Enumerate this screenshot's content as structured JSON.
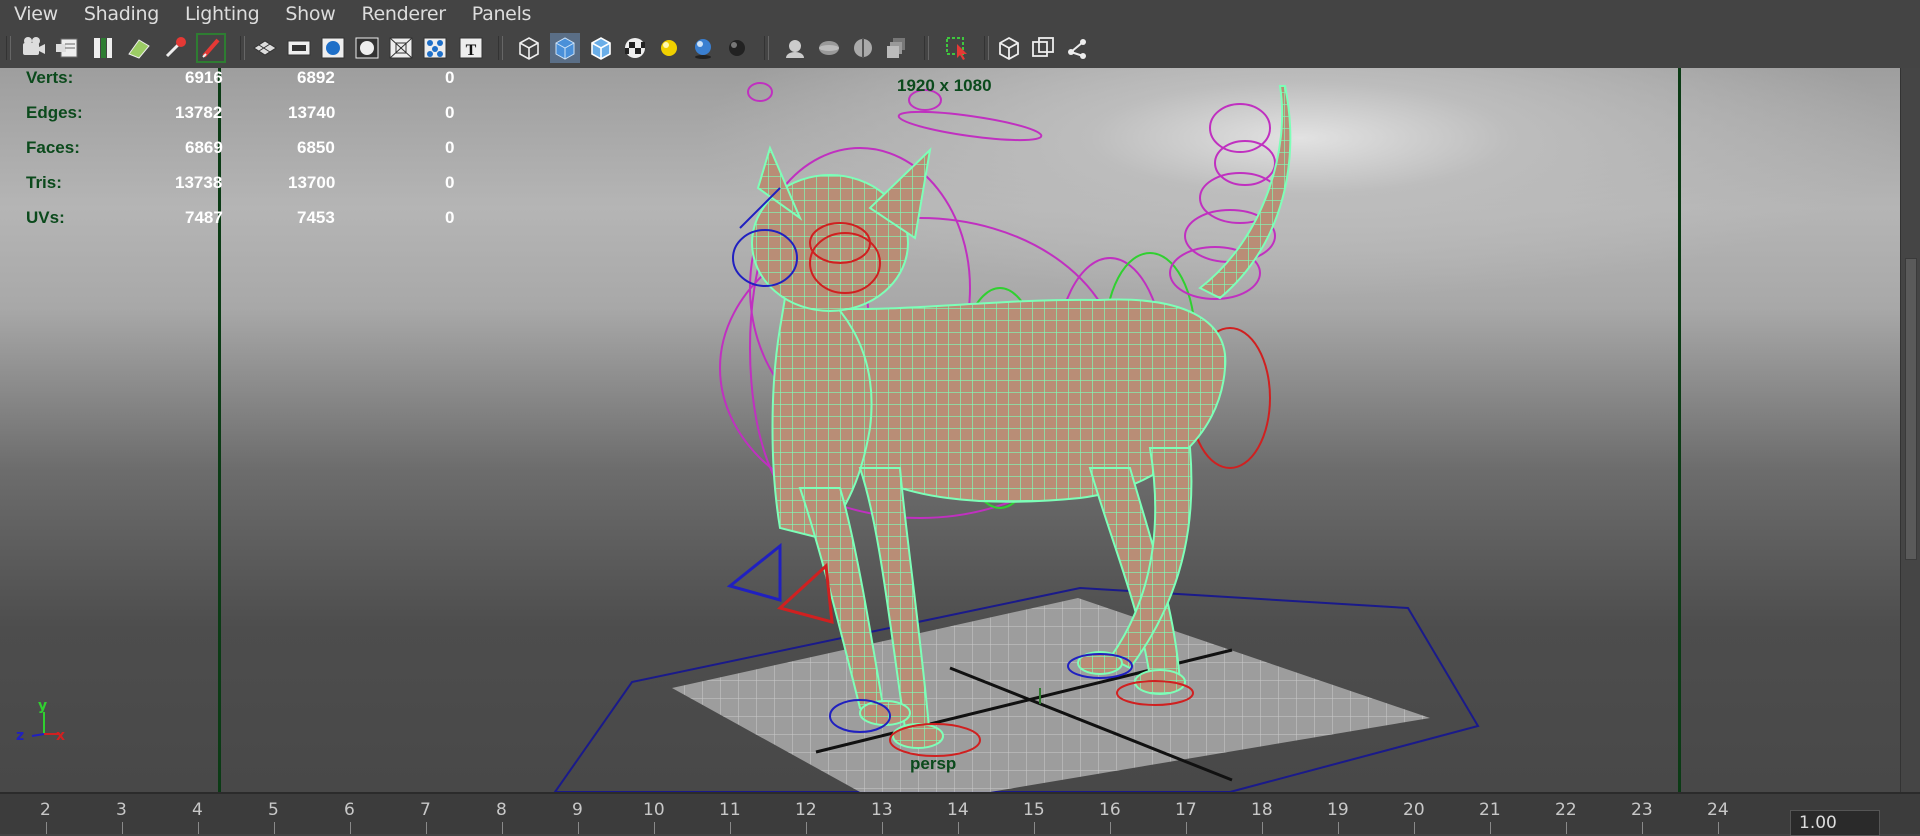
{
  "menu": [
    "View",
    "Shading",
    "Lighting",
    "Show",
    "Renderer",
    "Panels"
  ],
  "toolbar": {
    "icons": [
      "select-camera-icon",
      "camera-attributes-icon",
      "bookmarks-icon",
      "image-plane-icon",
      "2d-pan-zoom-icon",
      "grease-pencil-icon",
      "grid-icon",
      "film-gate-icon",
      "resolution-gate-icon",
      "gate-mask-icon",
      "field-chart-icon",
      "safe-action-icon",
      "safe-title-icon",
      "wireframe-icon",
      "smooth-shade-icon",
      "wireframe-on-shaded-icon",
      "textured-icon",
      "use-all-lights-icon",
      "shadows-icon",
      "screen-space-ao-icon",
      "motion-blur-icon",
      "multisample-aa-icon",
      "depth-of-field-icon",
      "hardware-fog-icon",
      "isolate-select-icon",
      "xray-icon",
      "xray-active-components-icon",
      "xray-joints-icon"
    ]
  },
  "viewport": {
    "stats": [
      {
        "label": "Verts:",
        "total": "6916",
        "selected": "6892",
        "extra": "0"
      },
      {
        "label": "Edges:",
        "total": "13782",
        "selected": "13740",
        "extra": "0"
      },
      {
        "label": "Faces:",
        "total": "6869",
        "selected": "6850",
        "extra": "0"
      },
      {
        "label": "Tris:",
        "total": "13738",
        "selected": "13700",
        "extra": "0"
      },
      {
        "label": "UVs:",
        "total": "7487",
        "selected": "7453",
        "extra": "0"
      }
    ],
    "resolution": "1920 x 1080",
    "camera": "persp",
    "axis": {
      "y": "y",
      "z": "z",
      "x": "x"
    },
    "colors": {
      "wire": "#7dffb8",
      "rig_magenta": "#c030c0",
      "rig_red": "#d02020",
      "rig_blue": "#2020c0",
      "rig_green": "#30d030",
      "hud_label": "#0b4a1c"
    }
  },
  "timeline": {
    "ticks": [
      "2",
      "3",
      "4",
      "5",
      "6",
      "7",
      "8",
      "9",
      "10",
      "11",
      "12",
      "13",
      "14",
      "15",
      "16",
      "17",
      "18",
      "19",
      "20",
      "21",
      "22",
      "23",
      "24"
    ],
    "current_value": "1.00"
  }
}
